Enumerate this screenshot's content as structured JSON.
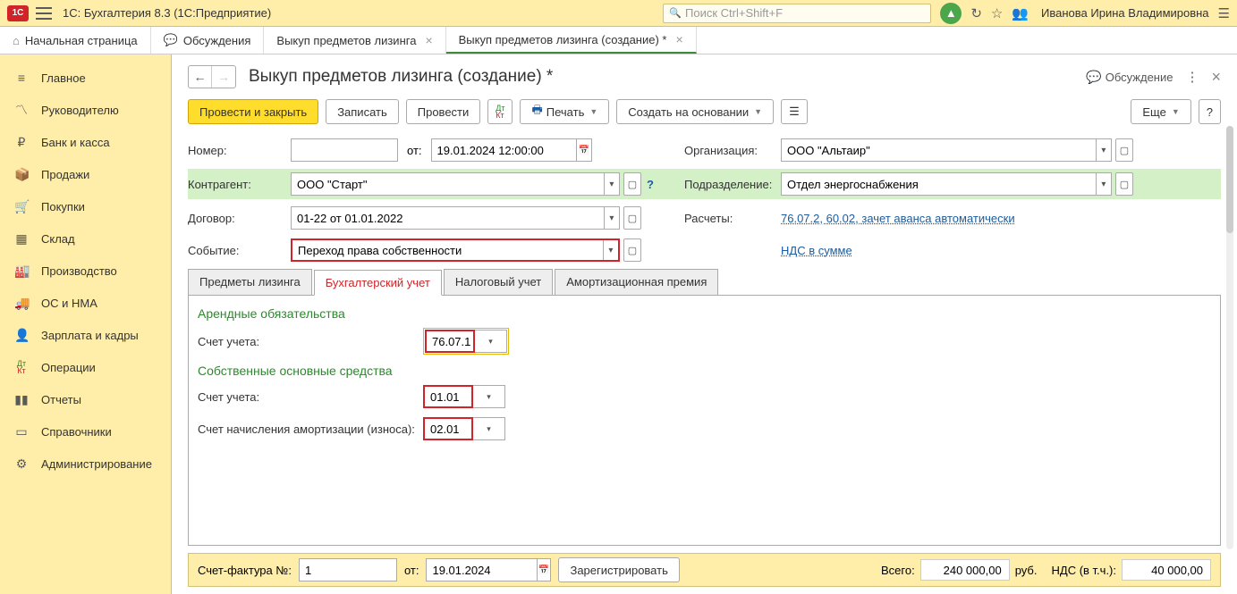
{
  "app_title": "1С: Бухгалтерия 8.3  (1С:Предприятие)",
  "search_placeholder": "Поиск Ctrl+Shift+F",
  "user": "Иванова Ирина Владимировна",
  "top_tabs": [
    {
      "label": "Начальная страница"
    },
    {
      "label": "Обсуждения"
    },
    {
      "label": "Выкуп предметов лизинга"
    },
    {
      "label": "Выкуп предметов лизинга (создание) *"
    }
  ],
  "sidebar": [
    {
      "label": "Главное"
    },
    {
      "label": "Руководителю"
    },
    {
      "label": "Банк и касса"
    },
    {
      "label": "Продажи"
    },
    {
      "label": "Покупки"
    },
    {
      "label": "Склад"
    },
    {
      "label": "Производство"
    },
    {
      "label": "ОС и НМА"
    },
    {
      "label": "Зарплата и кадры"
    },
    {
      "label": "Операции"
    },
    {
      "label": "Отчеты"
    },
    {
      "label": "Справочники"
    },
    {
      "label": "Администрирование"
    }
  ],
  "page_title": "Выкуп предметов лизинга (создание) *",
  "discussion_btn": "Обсуждение",
  "toolbar": {
    "post_close": "Провести и закрыть",
    "save": "Записать",
    "post": "Провести",
    "print": "Печать",
    "create_based": "Создать на основании",
    "more": "Еще"
  },
  "form": {
    "number_label": "Номер:",
    "number_value": "",
    "from_label": "от:",
    "date_value": "19.01.2024 12:00:00",
    "org_label": "Организация:",
    "org_value": "ООО \"Альтаир\"",
    "counterparty_label": "Контрагент:",
    "counterparty_value": "ООО \"Старт\"",
    "division_label": "Подразделение:",
    "division_value": "Отдел энергоснабжения",
    "contract_label": "Договор:",
    "contract_value": "01-22 от 01.01.2022",
    "settlements_label": "Расчеты:",
    "settlements_link": "76.07.2, 60.02, зачет аванса автоматически",
    "event_label": "Событие:",
    "event_value": "Переход права собственности",
    "vat_link": "НДС в сумме"
  },
  "tabs": [
    {
      "label": "Предметы лизинга"
    },
    {
      "label": "Бухгалтерский учет"
    },
    {
      "label": "Налоговый учет"
    },
    {
      "label": "Амортизационная премия"
    }
  ],
  "accounting": {
    "section1_title": "Арендные обязательства",
    "acct_label": "Счет учета:",
    "lease_acct": "76.07.1",
    "section2_title": "Собственные основные средства",
    "own_acct": "01.01",
    "deprec_label": "Счет начисления амортизации (износа):",
    "deprec_acct": "02.01"
  },
  "footer": {
    "invoice_label": "Счет-фактура №:",
    "invoice_no": "1",
    "invoice_from": "от:",
    "invoice_date": "19.01.2024",
    "register": "Зарегистрировать",
    "total_label": "Всего:",
    "total_value": "240 000,00",
    "currency": "руб.",
    "vat_label": "НДС (в т.ч.):",
    "vat_value": "40 000,00"
  }
}
